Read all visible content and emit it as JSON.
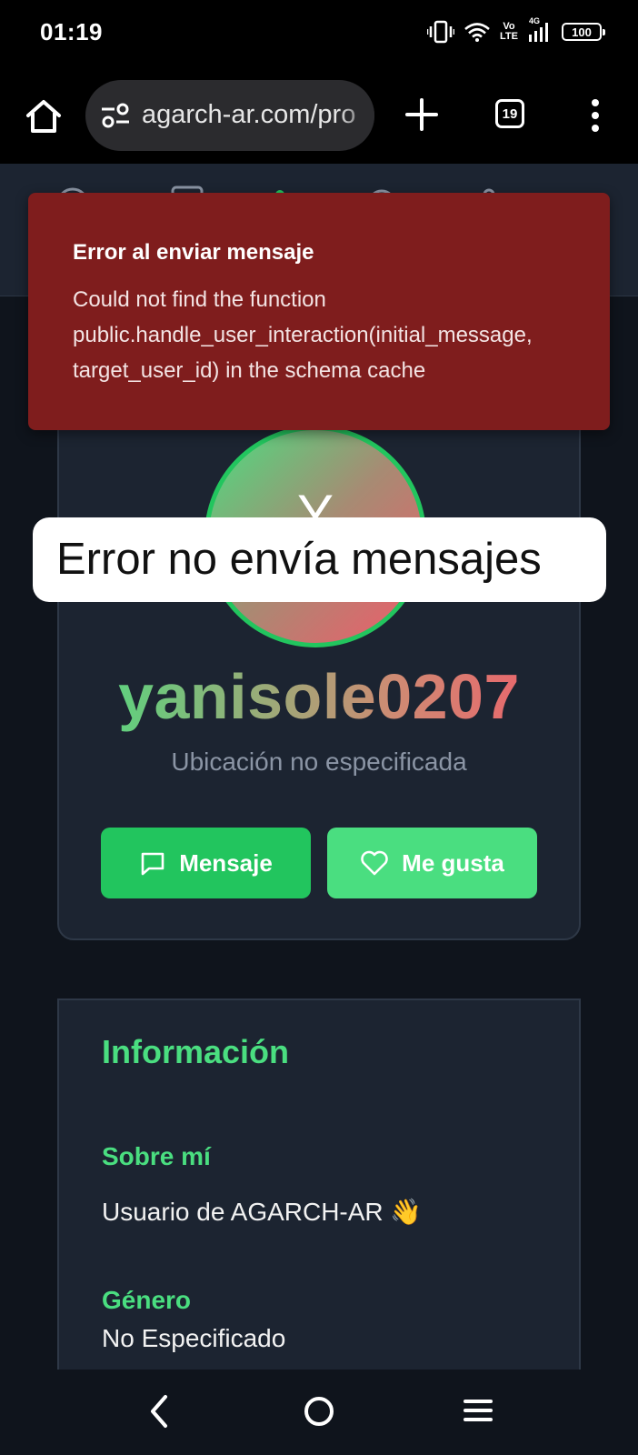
{
  "status_bar": {
    "time": "01:19",
    "volte_top": "Vo",
    "volte_bottom": "LTE",
    "network": "4G",
    "battery": "100"
  },
  "browser": {
    "url": "agarch-ar.com/pro",
    "tab_count": "19"
  },
  "profile": {
    "avatar_initial": "Y",
    "username": "yanisole0207",
    "location": "Ubicación no especificada",
    "message_button": "Mensaje",
    "like_button": "Me gusta"
  },
  "info": {
    "title": "Información",
    "about_label": "Sobre mí",
    "about_value": "Usuario de AGARCH-AR 👋",
    "gender_label": "Género",
    "gender_value": "No Especificado"
  },
  "toast": {
    "title": "Error al enviar mensaje",
    "message": "Could not find the function public.handle_user_interaction(initial_message, target_user_id) in the schema cache"
  },
  "caption": {
    "text": "Error no envía mensajes"
  },
  "colors": {
    "accent_green": "#22c55e",
    "light_green": "#4ade80",
    "error_red": "#7f1d1d",
    "card_bg": "#1c2431",
    "page_bg": "#0f141c"
  }
}
